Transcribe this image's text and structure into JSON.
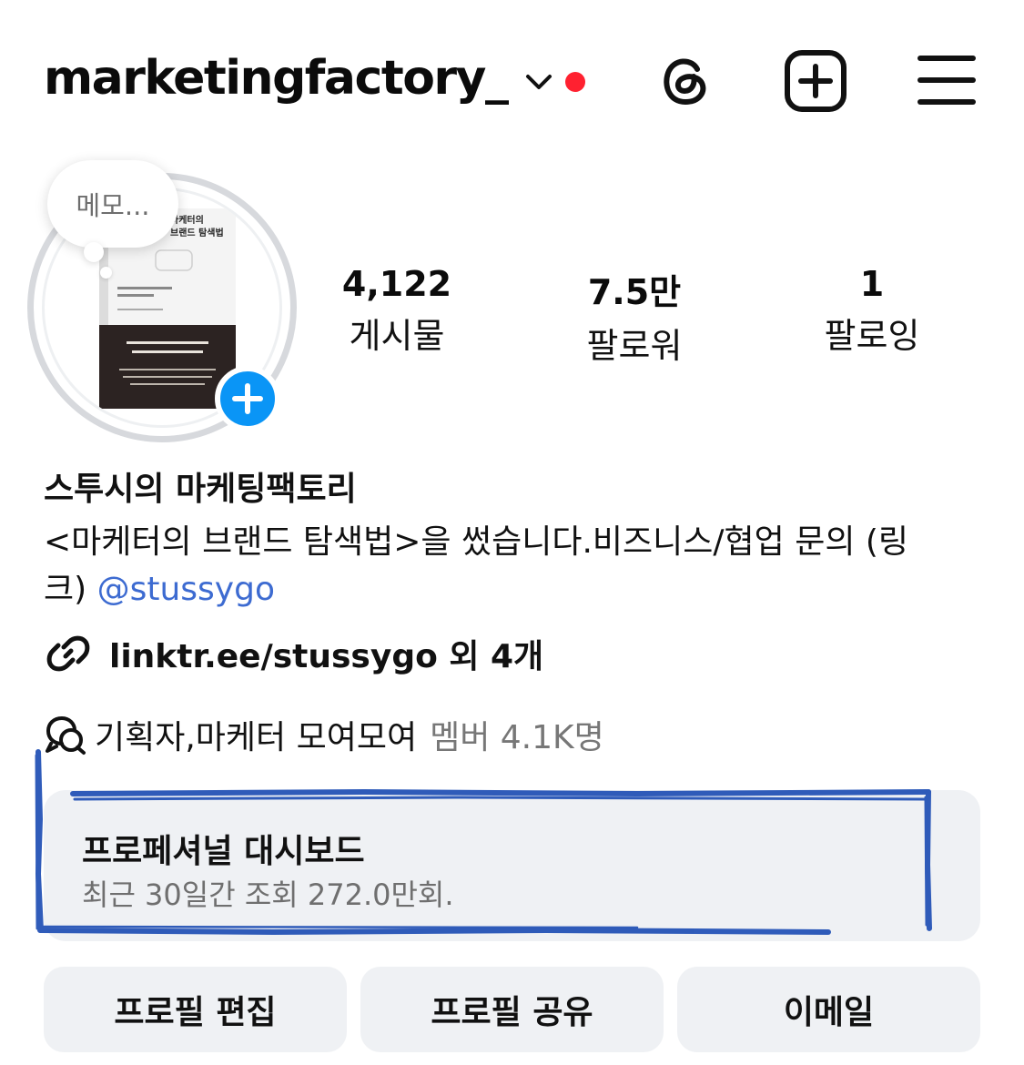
{
  "header": {
    "username": "marketingfactory_",
    "icons": [
      "chevron-down-icon",
      "notification-dot",
      "threads-icon",
      "create-post-icon",
      "menu-icon"
    ],
    "accent_red": "#ff2130"
  },
  "profile": {
    "memo_bubble": "메모...",
    "book_cover": {
      "title_line1": "마케터의",
      "title_line2": "브랜드 탐색법"
    },
    "stats": [
      {
        "value": "4,122",
        "label": "게시물"
      },
      {
        "value": "7.5만",
        "label": "팔로워"
      },
      {
        "value": "1",
        "label": "팔로잉"
      }
    ]
  },
  "bio": {
    "name": "스투시의 마케팅팩토리",
    "line1": "<마케터의 브랜드 탐색법>을 썼습니다.비즈니스/협업 문의 (링",
    "line2_prefix": "크) ",
    "mention": "@stussygo",
    "link": "linktr.ee/stussygo 외 4개",
    "channel_name": "기획자,마케터 모여모여",
    "channel_members": "멤버 4.1K명",
    "mention_color": "#3d6bd1"
  },
  "dashboard": {
    "title": "프로페셔널 대시보드",
    "subtitle": "최근 30일간 조회 272.0만회."
  },
  "buttons": {
    "edit_profile": "프로필 편집",
    "share_profile": "프로필 공유",
    "email": "이메일"
  },
  "colors": {
    "badge_blue": "#0a95f6",
    "button_bg": "#eff1f4",
    "annotation_blue": "#1f4fb5"
  }
}
